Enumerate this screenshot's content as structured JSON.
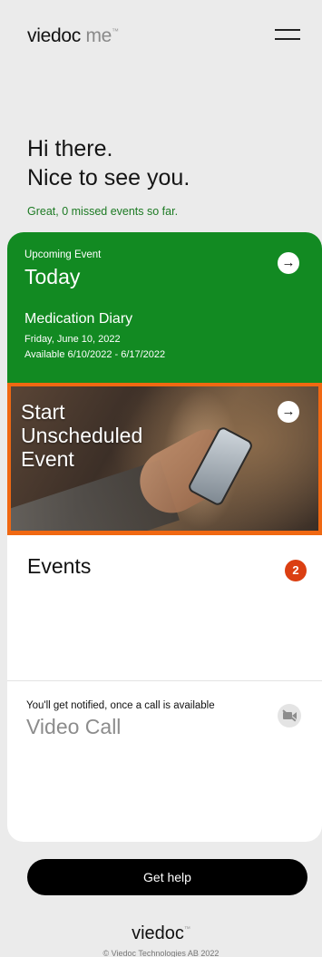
{
  "header": {
    "brand": "viedoc",
    "brand_suffix": "me",
    "trademark": "™",
    "menu_icon": "hamburger-menu-icon"
  },
  "greeting": {
    "line1": "Hi there.",
    "line2": "Nice to see you.",
    "missed_events": "Great, 0 missed events so far."
  },
  "upcoming_event": {
    "label": "Upcoming Event",
    "when": "Today",
    "title": "Medication Diary",
    "date": "Friday, June 10, 2022",
    "available": "Available 6/10/2022 - 6/17/2022",
    "arrow_icon": "arrow-right-icon",
    "color": "#128a22"
  },
  "unscheduled_event": {
    "line1": "Start",
    "line2": "Unscheduled",
    "line3": "Event",
    "arrow_icon": "arrow-right-icon",
    "highlight_color": "#f06812"
  },
  "events": {
    "title": "Events",
    "count": "2",
    "badge_color": "#db3f12"
  },
  "video_call": {
    "note": "You'll get notified, once a call is available",
    "title": "Video Call",
    "icon": "video-off-icon"
  },
  "help": {
    "label": "Get help"
  },
  "footer": {
    "brand": "viedoc",
    "trademark": "™",
    "copyright": "© Viedoc Technologies AB 2022"
  }
}
